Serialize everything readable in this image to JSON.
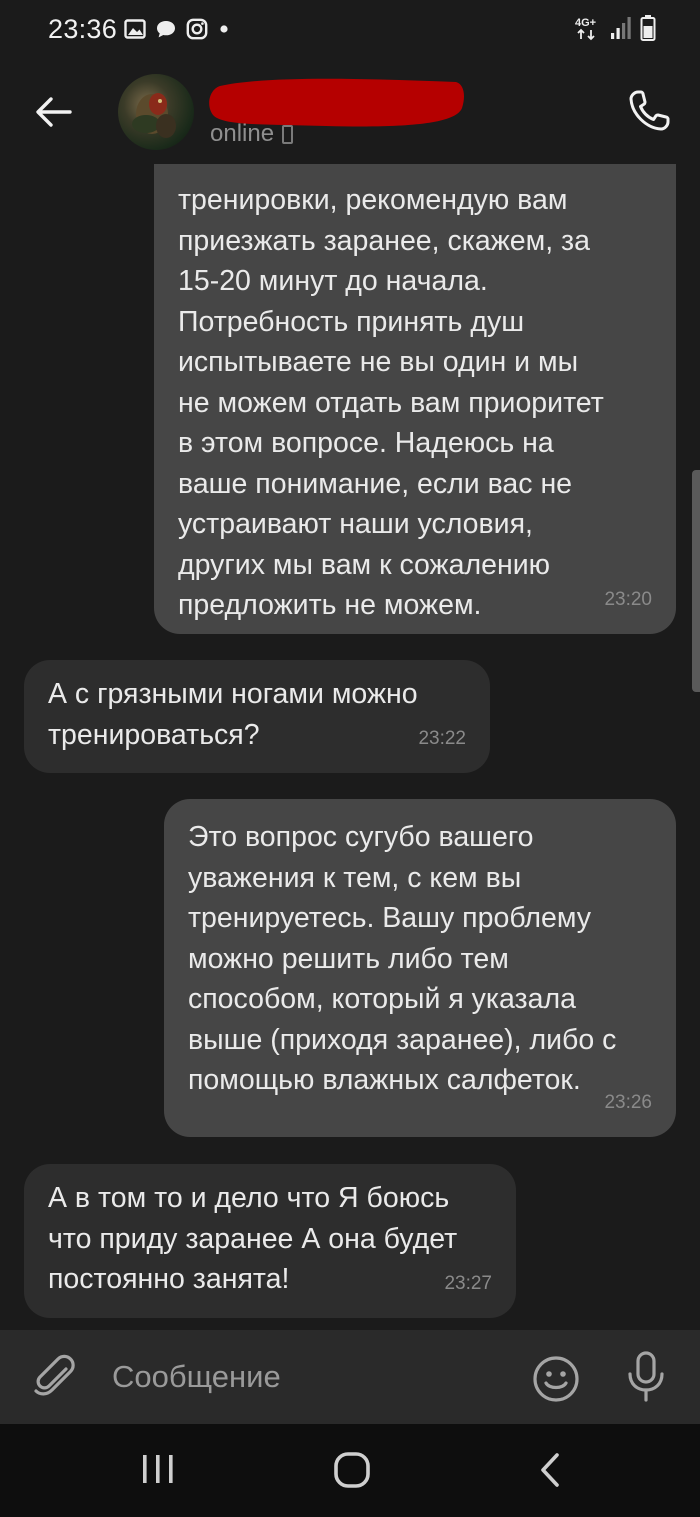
{
  "status_bar": {
    "time": "23:36",
    "network": "4G+",
    "left_icons": [
      "image-icon",
      "chat-bubble-icon",
      "instagram-icon",
      "dot-icon"
    ],
    "right_icons": [
      "network-4g-icon",
      "signal-icon",
      "battery-icon"
    ]
  },
  "header": {
    "contact_name": "",
    "status": "online",
    "status_device_icon": "mobile-device-icon",
    "icons": [
      "back-arrow-icon",
      "phone-icon"
    ]
  },
  "messages": [
    {
      "direction": "outgoing",
      "text": "тренировки, рекомендую вам\nприезжать заранее, скажем, за\n15-20 минут до начала.\nПотребность принять душ\nиспытываете не вы один и мы\nне можем отдать вам приоритет\nв этом вопросе. Надеюсь на\nваше понимание, если вас не\nустраивают наши условия,\nдругих мы вам к сожалению\nпредложить не можем.",
      "time": "23:20"
    },
    {
      "direction": "incoming",
      "text": "А с грязными ногами можно\nтренироваться?",
      "time": "23:22"
    },
    {
      "direction": "outgoing",
      "text": "Это вопрос сугубо вашего\nуважения к тем, с кем вы\nтренируетесь. Вашу проблему\nможно решить либо тем\nспособом, который я указала\nвыше (приходя заранее), либо с\nпомощью влажных салфеток.",
      "time": "23:26"
    },
    {
      "direction": "incoming",
      "text": "А в том то и дело что Я боюсь\nчто приду заранее А она будет\nпостоянно занята!",
      "time": "23:27"
    }
  ],
  "input_bar": {
    "placeholder": "Сообщение",
    "icons": [
      "paperclip-icon",
      "emoji-icon",
      "microphone-icon"
    ]
  },
  "nav_bar": {
    "icons": [
      "recent-apps-icon",
      "home-icon",
      "nav-back-icon"
    ]
  },
  "colors": {
    "background": "#1b1b1b",
    "outgoing_bubble": "#464646",
    "incoming_bubble": "#2d2d2d",
    "input_bar": "#2a2a2a",
    "nav_bar": "#0e0e0e",
    "redaction": "#b50000"
  }
}
